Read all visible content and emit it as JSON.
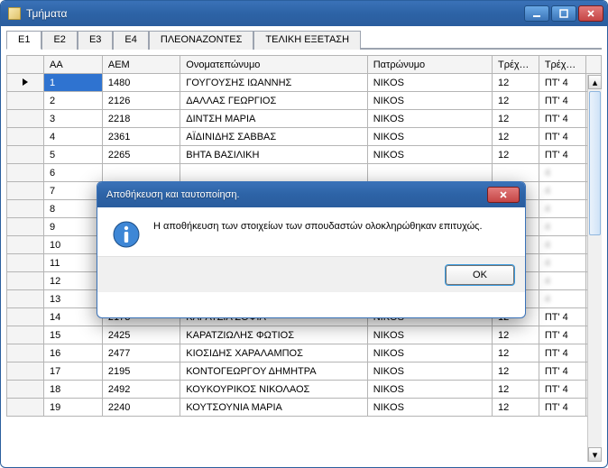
{
  "window": {
    "title": "Τμήματα"
  },
  "tabs": {
    "items": [
      "Ε1",
      "Ε2",
      "Ε3",
      "Ε4",
      "ΠΛΕΟΝΑΖΟΝΤΕΣ",
      "ΤΕΛΙΚΗ ΕΞΕΤΑΣΗ"
    ],
    "active_index": 0
  },
  "grid": {
    "headers": {
      "aa": "ΑΑ",
      "aem": "ΑΕΜ",
      "onom": "Ονοματεπώνυμο",
      "patr": "Πατρώνυμο",
      "exa": "Τρέχον εξάμηνο",
      "exb": "Τρέχον εξάμηνο"
    },
    "rows": [
      {
        "aa": "1",
        "aem": "1480",
        "onom": "ΓΟΥΓΟΥΣΗΣ ΙΩΑΝΝΗΣ",
        "patr": "NIKOS",
        "exa": "12",
        "exb": "ΠΤ' 4",
        "sel": true
      },
      {
        "aa": "2",
        "aem": "2126",
        "onom": "ΔΑΛΛΑΣ ΓΕΩΡΓΙΟΣ",
        "patr": "NIKOS",
        "exa": "12",
        "exb": "ΠΤ' 4"
      },
      {
        "aa": "3",
        "aem": "2218",
        "onom": "ΔΙΝΤΣΗ ΜΑΡΙΑ",
        "patr": "NIKOS",
        "exa": "12",
        "exb": "ΠΤ' 4"
      },
      {
        "aa": "4",
        "aem": "2361",
        "onom": "ΑΪΔΙΝΙΔΗΣ ΣΑΒΒΑΣ",
        "patr": "NIKOS",
        "exa": "12",
        "exb": "ΠΤ' 4"
      },
      {
        "aa": "5",
        "aem": "2265",
        "onom": "ΒΗΤΑ ΒΑΣΙΛΙΚΗ",
        "patr": "NIKOS",
        "exa": "12",
        "exb": "ΠΤ' 4"
      },
      {
        "aa": "6",
        "aem": "",
        "onom": "",
        "patr": "",
        "exa": "",
        "exb": "4",
        "blur": true
      },
      {
        "aa": "7",
        "aem": "",
        "onom": "",
        "patr": "",
        "exa": "",
        "exb": "4",
        "blur": true
      },
      {
        "aa": "8",
        "aem": "",
        "onom": "",
        "patr": "",
        "exa": "",
        "exb": "4",
        "blur": true
      },
      {
        "aa": "9",
        "aem": "",
        "onom": "",
        "patr": "",
        "exa": "",
        "exb": "4",
        "blur": true
      },
      {
        "aa": "10",
        "aem": "",
        "onom": "",
        "patr": "",
        "exa": "",
        "exb": "4",
        "blur": true
      },
      {
        "aa": "11",
        "aem": "",
        "onom": "",
        "patr": "",
        "exa": "",
        "exb": "4",
        "blur": true
      },
      {
        "aa": "12",
        "aem": "",
        "onom": "",
        "patr": "",
        "exa": "",
        "exb": "4",
        "blur": true
      },
      {
        "aa": "13",
        "aem": "",
        "onom": "",
        "patr": "",
        "exa": "",
        "exb": "4",
        "blur": true
      },
      {
        "aa": "14",
        "aem": "2173",
        "onom": "ΚΑΡΑΤΖΙΑ ΣΟΦΙΑ",
        "patr": "NIKOS",
        "exa": "12",
        "exb": "ΠΤ' 4"
      },
      {
        "aa": "15",
        "aem": "2425",
        "onom": "ΚΑΡΑΤΖΙΩΛΗΣ ΦΩΤΙΟΣ",
        "patr": "NIKOS",
        "exa": "12",
        "exb": "ΠΤ' 4"
      },
      {
        "aa": "16",
        "aem": "2477",
        "onom": "ΚΙΟΣΙΔΗΣ ΧΑΡΑΛΑΜΠΟΣ",
        "patr": "NIKOS",
        "exa": "12",
        "exb": "ΠΤ' 4"
      },
      {
        "aa": "17",
        "aem": "2195",
        "onom": "ΚΟΝΤΟΓΕΩΡΓΟΥ ΔΗΜΗΤΡΑ",
        "patr": "NIKOS",
        "exa": "12",
        "exb": "ΠΤ' 4"
      },
      {
        "aa": "18",
        "aem": "2492",
        "onom": "ΚΟΥΚΟΥΡΙΚΟΣ ΝΙΚΟΛΑΟΣ",
        "patr": "NIKOS",
        "exa": "12",
        "exb": "ΠΤ' 4"
      },
      {
        "aa": "19",
        "aem": "2240",
        "onom": "ΚΟΥΤΣΟΥΝΙΑ ΜΑΡΙΑ",
        "patr": "NIKOS",
        "exa": "12",
        "exb": "ΠΤ' 4"
      }
    ]
  },
  "dialog": {
    "title": "Αποθήκευση και ταυτοποίηση.",
    "message": "Η αποθήκευση των στοιχείων των σπουδαστών ολοκληρώθηκαν επιτυχώς.",
    "ok": "OK"
  }
}
